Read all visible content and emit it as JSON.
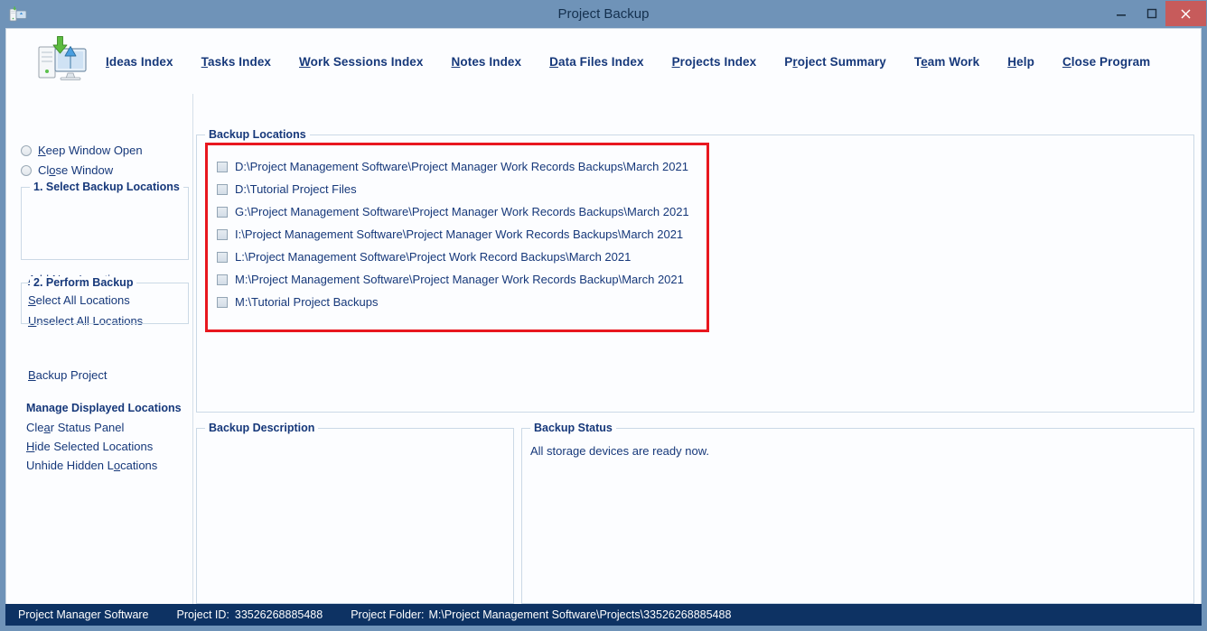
{
  "window": {
    "title": "Project Backup",
    "icon": "computer-backup-icon",
    "minimize_label": "–",
    "maximize_label": "❐",
    "close_label": "✕"
  },
  "header": {
    "app_icon": "computer-monitor-backup-icon",
    "menu": [
      {
        "label": "Ideas Index",
        "accel": "I",
        "rest": "deas Index"
      },
      {
        "label": "Tasks Index",
        "accel": "T",
        "rest": "asks Index"
      },
      {
        "label": "Work Sessions Index",
        "accel": "W",
        "rest": "ork Sessions Index"
      },
      {
        "label": "Notes Index",
        "accel": "N",
        "rest": "otes Index"
      },
      {
        "label": "Data Files Index",
        "accel": "D",
        "rest": "ata Files Index"
      },
      {
        "label": "Projects Index",
        "accel": "P",
        "rest": "rojects Index"
      },
      {
        "label": "Project Summary",
        "pre": "P",
        "accel": "r",
        "rest": "oject Summary"
      },
      {
        "label": "Team Work",
        "pre": "T",
        "accel": "e",
        "rest": "am Work"
      },
      {
        "label": "Help",
        "accel": "H",
        "rest": "elp"
      },
      {
        "label": "Close Program",
        "accel": "C",
        "rest": "lose Program"
      }
    ]
  },
  "sidebar": {
    "radios": [
      {
        "label": "Keep Window Open",
        "accel": "K",
        "rest": "eep Window Open",
        "selected": false
      },
      {
        "label": "Close Window",
        "pre": "Cl",
        "accel": "o",
        "rest": "se Window",
        "selected": false
      }
    ],
    "group_select": {
      "title": "1. Select Backup Locations",
      "links": [
        {
          "label": "Add New Location",
          "accel": "A",
          "rest": "dd New Location"
        },
        {
          "label": "Select All Locations",
          "accel": "S",
          "rest": "elect All Locations"
        },
        {
          "label": "Unselect All Locations",
          "accel": "U",
          "rest": "nselect All Locations"
        }
      ]
    },
    "group_perform": {
      "title": "2. Perform Backup",
      "links": [
        {
          "label": "Backup Project",
          "accel": "B",
          "rest": "ackup Project"
        }
      ]
    },
    "manage": {
      "title": "Manage Displayed Locations",
      "links": [
        {
          "label": "Clear Status Panel",
          "pre": "Cle",
          "accel": "a",
          "rest": "r Status Panel"
        },
        {
          "label": "Hide Selected Locations",
          "accel": "H",
          "rest": "ide Selected Locations"
        },
        {
          "label": "Unhide Hidden Locations",
          "pre": "Unhide Hidden L",
          "accel": "o",
          "rest": "cations"
        }
      ]
    }
  },
  "main": {
    "locations_group_title": "Backup Locations",
    "locations": [
      {
        "label": "D:\\Project Management Software\\Project Manager Work Records Backups\\March 2021",
        "checked": false
      },
      {
        "label": "D:\\Tutorial Project Files",
        "checked": false
      },
      {
        "label": "G:\\Project Management Software\\Project Manager Work Records Backups\\March 2021",
        "checked": false
      },
      {
        "label": "I:\\Project Management Software\\Project Manager Work Records Backups\\March 2021",
        "checked": false
      },
      {
        "label": "L:\\Project Management Software\\Project Work Record Backups\\March 2021",
        "checked": false
      },
      {
        "label": "M:\\Project Management Software\\Project Manager Work Records Backup\\March 2021",
        "checked": false
      },
      {
        "label": "M:\\Tutorial Project Backups",
        "checked": false
      }
    ],
    "description_group_title": "Backup Description",
    "description_value": "",
    "status_group_title": "Backup Status",
    "status_message": "All storage devices are ready now."
  },
  "statusbar": {
    "app_name": "Project Manager Software",
    "project_id_label": "Project ID:",
    "project_id_value": "33526268885488",
    "project_folder_label": "Project Folder:",
    "project_folder_value": "M:\\Project Management Software\\Projects\\33526268885488"
  },
  "colors": {
    "titlebar": "#6f93b8",
    "close_button": "#c75b5b",
    "text_blue": "#16387a",
    "statusbar": "#0d3263",
    "highlight_red": "#e8171f",
    "client_bg": "#fcfdff"
  }
}
